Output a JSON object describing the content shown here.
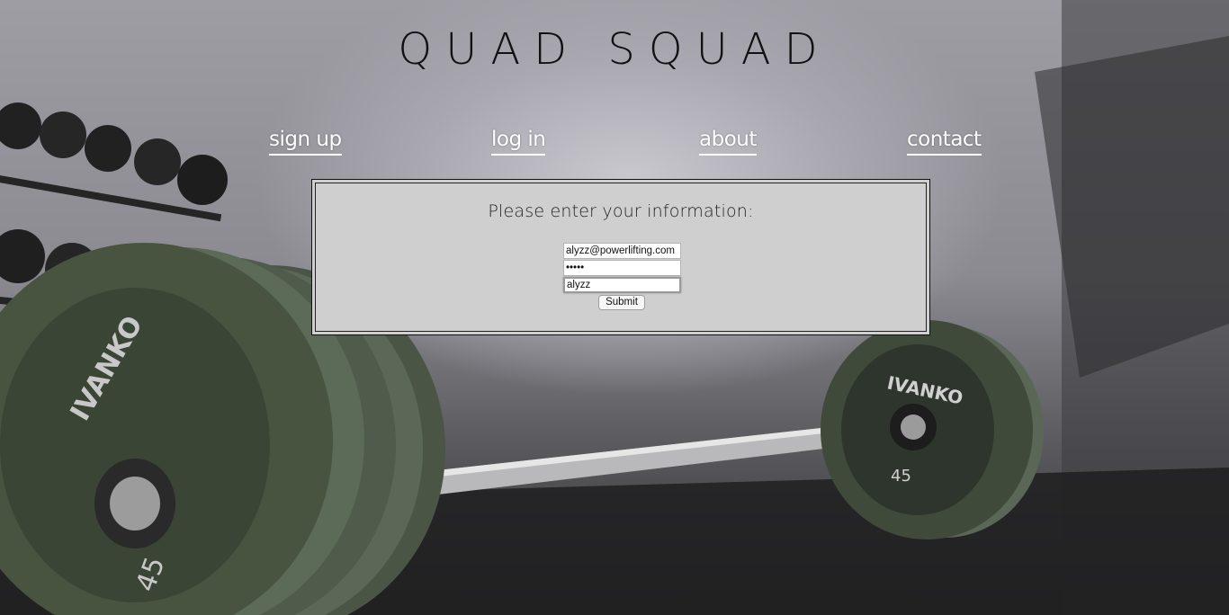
{
  "site": {
    "title": "QUAD SQUAD"
  },
  "nav": {
    "items": [
      {
        "label": "sign up"
      },
      {
        "label": "log in"
      },
      {
        "label": "about"
      },
      {
        "label": "contact"
      }
    ]
  },
  "form": {
    "prompt": "Please enter your information:",
    "email_value": "alyzz@powerlifting.com",
    "password_value": "•••••",
    "username_value": "alyzz",
    "submit_label": "Submit"
  },
  "background": {
    "plate_text_left": "IVANKO",
    "plate_text_right": "IVANKO",
    "plate_weight_right": "45",
    "plate_weight_left": "45"
  },
  "colors": {
    "panel_background": "#cfcfcf",
    "nav_text": "#ffffff",
    "title_text": "#111111"
  }
}
